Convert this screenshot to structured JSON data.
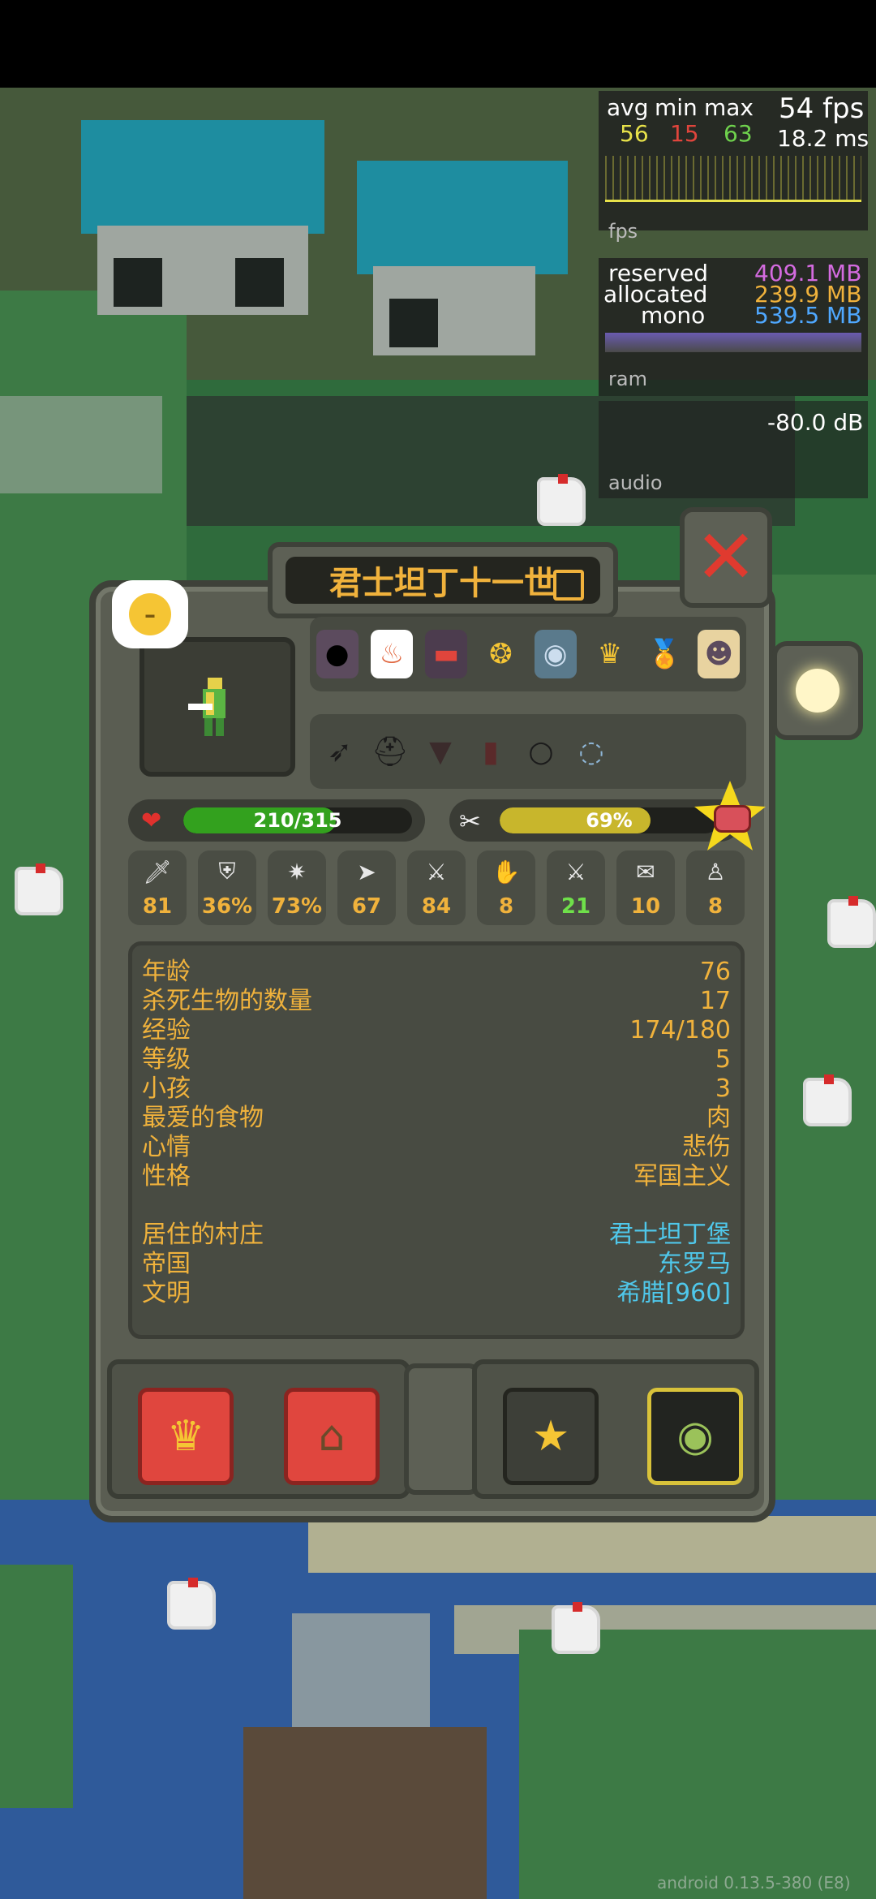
{
  "debug": {
    "fps": {
      "avg_label": "avg",
      "min_label": "min",
      "max_label": "max",
      "fps_value": "54 fps",
      "avg_value": "56",
      "min_value": "15",
      "max_value": "63",
      "ms_value": "18.2 ms",
      "graph_label": "fps"
    },
    "ram": {
      "reserved_label": "reserved",
      "reserved_value": "409.1 MB",
      "allocated_label": "allocated",
      "allocated_value": "239.9 MB",
      "mono_label": "mono",
      "mono_value": "539.5 MB",
      "graph_label": "ram"
    },
    "audio": {
      "db_value": "-80.0 dB",
      "label": "audio"
    },
    "colors": {
      "avg": "#e8e24a",
      "min": "#e0453c",
      "max": "#6fd24d",
      "reserved": "#d46be0",
      "allocated": "#f0b23c",
      "mono": "#4fa8ff"
    }
  },
  "unit": {
    "name": "君士坦丁十一世",
    "mood_icon": "neutral-face-icon",
    "health": {
      "current": 210,
      "max": 315,
      "label": "210/315"
    },
    "hunger": {
      "percent": 69,
      "label": "69%"
    },
    "traits": [
      "bald-trait-icon",
      "fire-trait-icon",
      "dark-trait-icon",
      "gold-trait-icon",
      "bubble-trait-icon",
      "tooth-trait-icon",
      "medal-trait-icon",
      "blonde-trait-icon"
    ],
    "items": [
      "bow-icon",
      "helmet-icon",
      "armor-icon",
      "boots-icon",
      "ring-icon",
      "amulet-icon"
    ],
    "stats": [
      {
        "icon": "sword-icon",
        "value": "81",
        "color": "#f0b23c"
      },
      {
        "icon": "shield-icon",
        "value": "36%",
        "color": "#f0b23c"
      },
      {
        "icon": "crit-icon",
        "value": "73%",
        "color": "#f0b23c"
      },
      {
        "icon": "speed-icon",
        "value": "67",
        "color": "#f0b23c"
      },
      {
        "icon": "attack-speed-icon",
        "value": "84",
        "color": "#f0b23c"
      },
      {
        "icon": "diplomacy-icon",
        "value": "8",
        "color": "#f0b23c"
      },
      {
        "icon": "warfare-icon",
        "value": "21",
        "color": "#6fe04a"
      },
      {
        "icon": "stewardship-icon",
        "value": "10",
        "color": "#f0b23c"
      },
      {
        "icon": "intelligence-icon",
        "value": "8",
        "color": "#f0b23c"
      }
    ],
    "info": [
      {
        "key": "年龄",
        "value": "76",
        "blue": false
      },
      {
        "key": "杀死生物的数量",
        "value": "17",
        "blue": false
      },
      {
        "key": "经验",
        "value": "174/180",
        "blue": false
      },
      {
        "key": "等级",
        "value": "5",
        "blue": false
      },
      {
        "key": "小孩",
        "value": "3",
        "blue": false
      },
      {
        "key": "最爱的食物",
        "value": "肉",
        "blue": false
      },
      {
        "key": "心情",
        "value": "悲伤",
        "blue": false
      },
      {
        "key": "性格",
        "value": "军国主义",
        "blue": false
      },
      {
        "key": "居住的村庄",
        "value": "君士坦丁堡",
        "blue": true
      },
      {
        "key": "帝国",
        "value": "东罗马",
        "blue": true
      },
      {
        "key": "文明",
        "value": "希腊[960]",
        "blue": true
      }
    ]
  },
  "footer": {
    "version": "android 0.13.5-380 (E8)"
  }
}
